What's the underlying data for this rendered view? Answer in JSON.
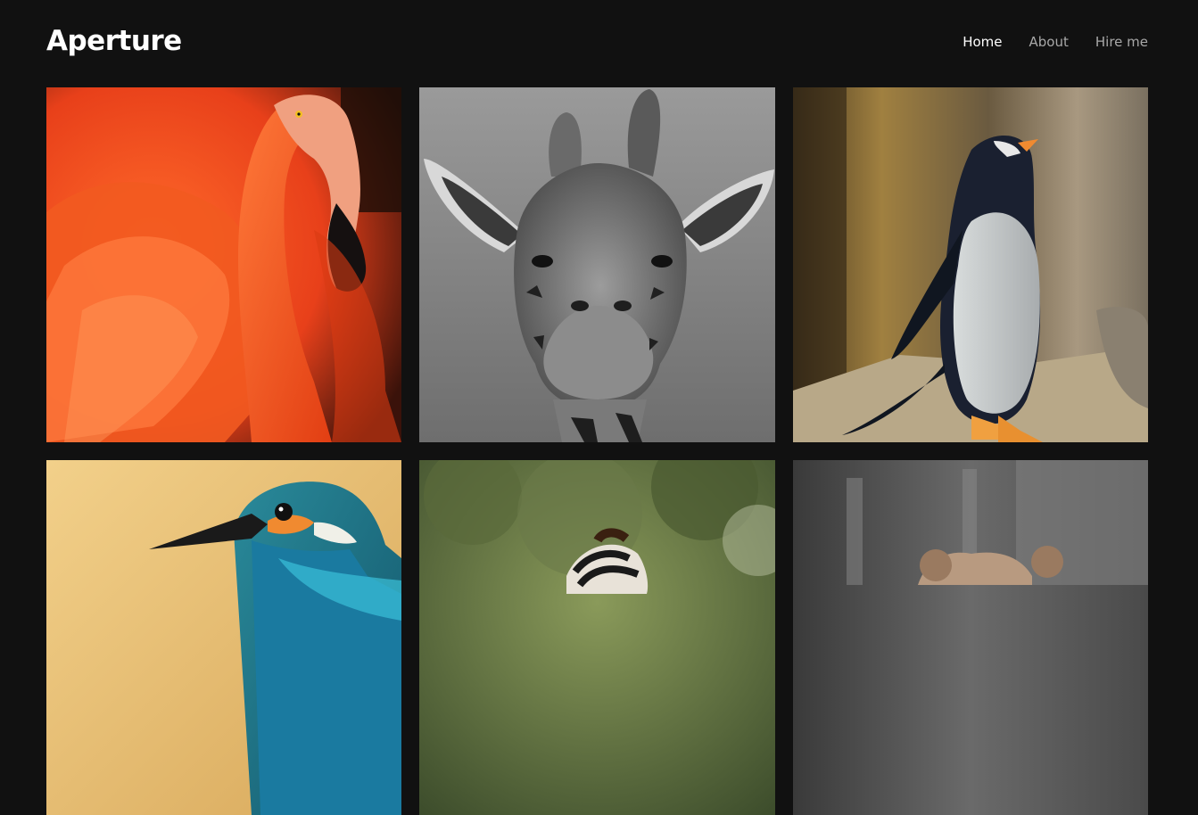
{
  "site": {
    "title": "Aperture"
  },
  "nav": {
    "items": [
      {
        "label": "Home",
        "active": true
      },
      {
        "label": "About",
        "active": false
      },
      {
        "label": "Hire me",
        "active": false
      }
    ]
  },
  "gallery": {
    "photos": [
      {
        "subject": "flamingo",
        "tone": "#e8451c"
      },
      {
        "subject": "giraffe",
        "tone": "#8a8a8a"
      },
      {
        "subject": "penguin",
        "tone": "#7a6438"
      },
      {
        "subject": "kingfisher",
        "tone": "#e6c27a"
      },
      {
        "subject": "zebra",
        "tone": "#5a6a3a"
      },
      {
        "subject": "bear",
        "tone": "#6a6a6a"
      }
    ]
  },
  "colors": {
    "background": "#111111",
    "nav_inactive": "#a8a8a8",
    "nav_active": "#ffffff"
  }
}
